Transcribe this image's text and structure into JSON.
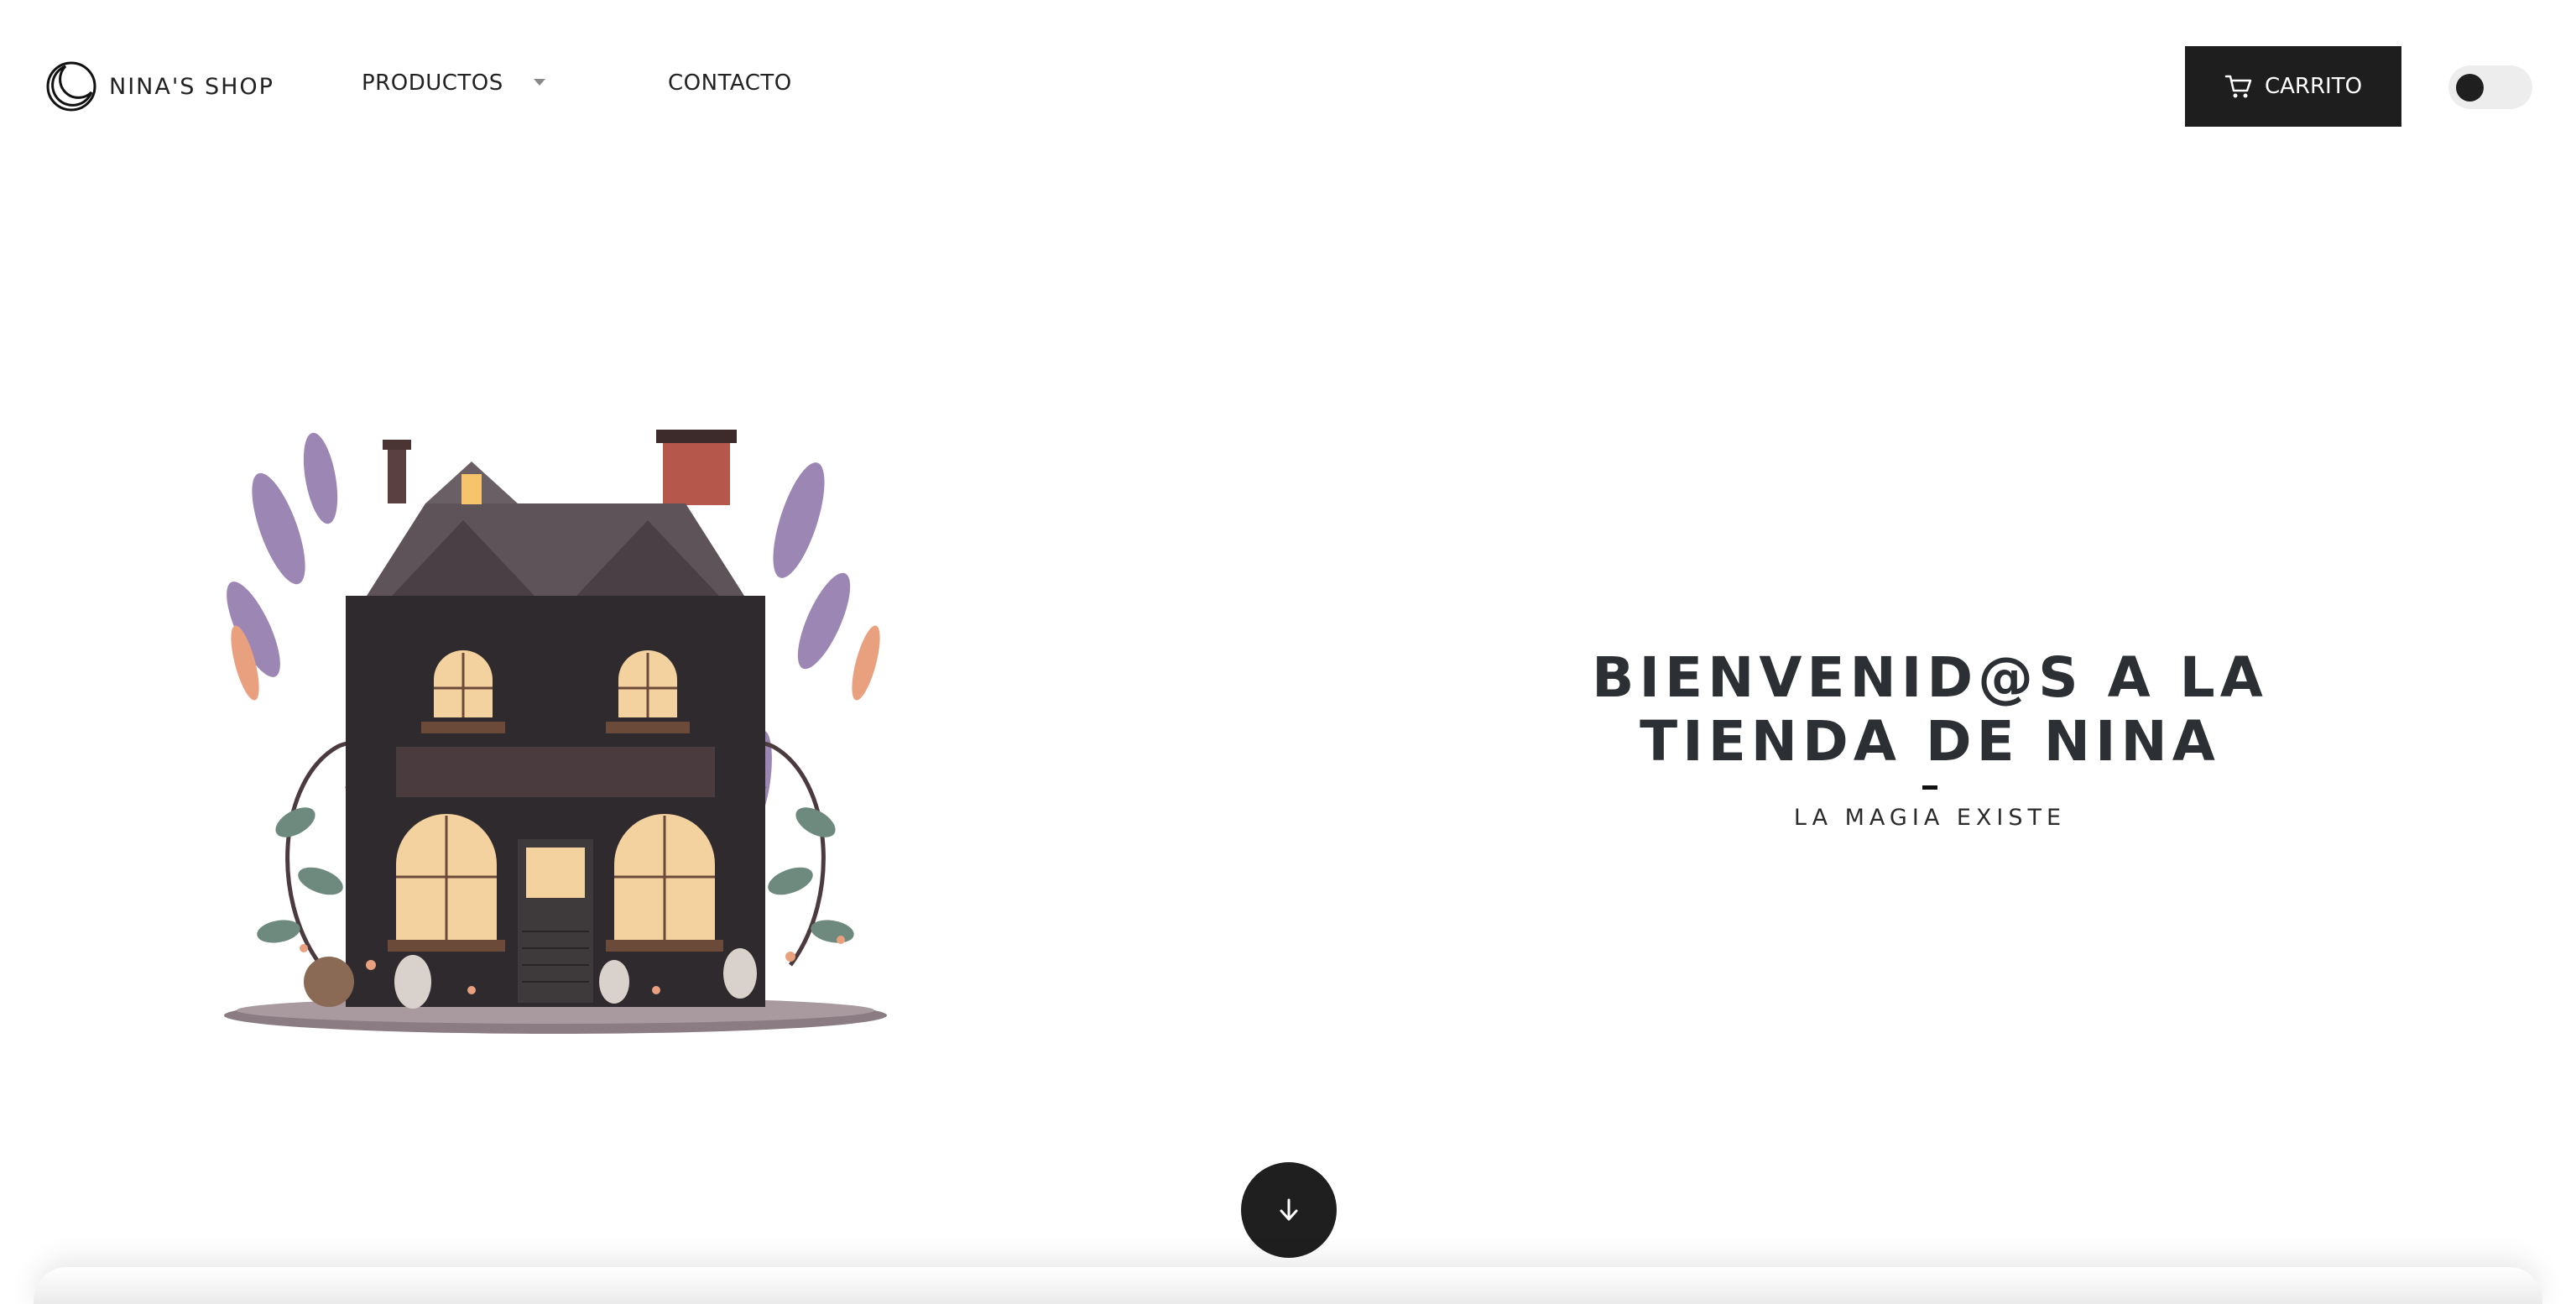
{
  "header": {
    "logo_text": "NINA'S SHOP",
    "nav": {
      "productos_label": "PRODUCTOS",
      "contacto_label": "CONTACTO"
    },
    "cart_label": "CARRITO",
    "icons": {
      "logo": "moon-logo-icon",
      "productos_dropdown": "caret-down-icon",
      "cart": "shopping-cart-icon"
    }
  },
  "hero": {
    "title_line1": "BIENVENID@S A LA",
    "title_line2": "TIENDA DE NINA",
    "subtitle": "LA MAGIA EXISTE",
    "illustration": "witch-cottage-shop-illustration",
    "scroll_icon": "arrow-down-icon"
  },
  "colors": {
    "background": "#ffffff",
    "dark": "#1e1e1e",
    "text": "#2c2f33",
    "toggle_track": "#ededed"
  }
}
